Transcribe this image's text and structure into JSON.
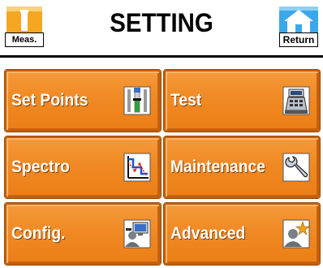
{
  "header": {
    "title": "SETTING",
    "meas_label": "Meas.",
    "return_label": "Return"
  },
  "tiles": [
    {
      "label": "Set Points",
      "icon": "set-points-icon"
    },
    {
      "label": "Test",
      "icon": "cash-register-icon"
    },
    {
      "label": "Spectro",
      "icon": "spectro-graph-icon"
    },
    {
      "label": "Maintenance",
      "icon": "wrench-icon"
    },
    {
      "label": "Config.",
      "icon": "user-computer-icon"
    },
    {
      "label": "Advanced",
      "icon": "user-star-icon"
    }
  ],
  "colors": {
    "tile": "#f08a24",
    "meas_icon": "#f5a623",
    "return_icon": "#2f9fe0"
  }
}
